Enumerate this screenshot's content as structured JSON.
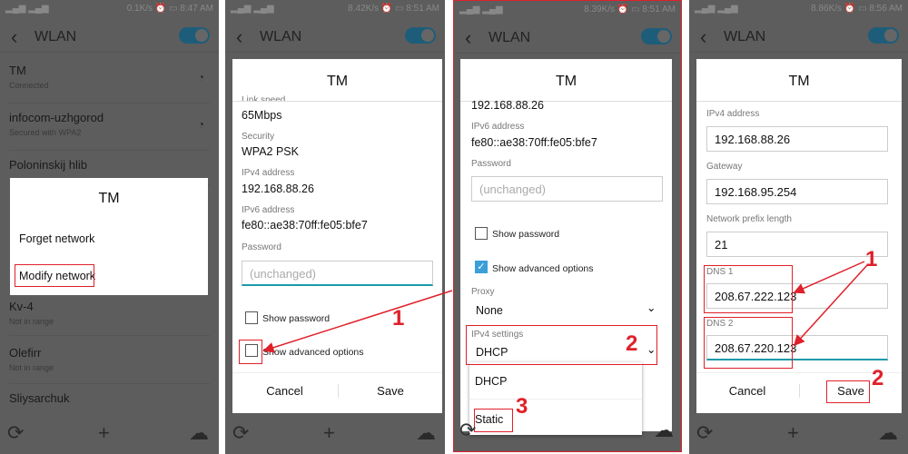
{
  "common": {
    "title": "WLAN",
    "dialog_title": "TM",
    "cancel": "Cancel",
    "save": "Save"
  },
  "p1": {
    "status": {
      "speed": "0.1K/s",
      "time": "8:47",
      "ampm": "AM"
    },
    "networks": [
      {
        "name": "TM",
        "status": "Connected"
      },
      {
        "name": "infocom-uzhgorod",
        "status": "Secured with WPA2"
      },
      {
        "name": "Poloninskij hlib",
        "status": ""
      },
      {
        "name": "Kv-4",
        "status": "Not in range"
      },
      {
        "name": "Olefirr",
        "status": "Not in range"
      },
      {
        "name": "Sliysarchuk",
        "status": ""
      }
    ],
    "menu": {
      "forget": "Forget network",
      "modify": "Modify network"
    }
  },
  "p2": {
    "status": {
      "speed": "8.42K/s",
      "time": "8:51",
      "ampm": "AM"
    },
    "link_speed_label": "Link speed",
    "link_speed": "65Mbps",
    "security_label": "Security",
    "security": "WPA2 PSK",
    "ipv4_label": "IPv4 address",
    "ipv4": "192.168.88.26",
    "ipv6_label": "IPv6 address",
    "ipv6": "fe80::ae38:70ff:fe05:bfe7",
    "password_label": "Password",
    "password_placeholder": "(unchanged)",
    "show_password": "Show password",
    "show_advanced": "Show advanced options"
  },
  "p3": {
    "status": {
      "speed": "8.39K/s",
      "time": "8:51",
      "ampm": "AM"
    },
    "ipv4": "192.168.88.26",
    "ipv6_label": "IPv6 address",
    "ipv6": "fe80::ae38:70ff:fe05:bfe7",
    "password_label": "Password",
    "password_placeholder": "(unchanged)",
    "show_password": "Show password",
    "show_advanced": "Show advanced options",
    "proxy_label": "Proxy",
    "proxy": "None",
    "ipv4_settings_label": "IPv4 settings",
    "ipv4_settings": "DHCP",
    "options": [
      "DHCP",
      "Static"
    ]
  },
  "p4": {
    "status": {
      "speed": "8.86K/s",
      "time": "8:56",
      "ampm": "AM"
    },
    "ipv4_label": "IPv4 address",
    "ipv4": "192.168.88.26",
    "gateway_label": "Gateway",
    "gateway": "192.168.95.254",
    "prefix_label": "Network prefix length",
    "prefix": "21",
    "dns1_label": "DNS 1",
    "dns1": "208.67.222.123",
    "dns2_label": "DNS 2",
    "dns2": "208.67.220.123"
  },
  "annotations": {
    "step1": "1",
    "step2": "2",
    "step3": "3",
    "step1b": "1",
    "step2b": "2"
  },
  "colors": {
    "annotation": "#e0202a",
    "accent": "#1e5d7a",
    "checkbox": "#3b9fd8",
    "input_focus": "#1a9aa8"
  }
}
